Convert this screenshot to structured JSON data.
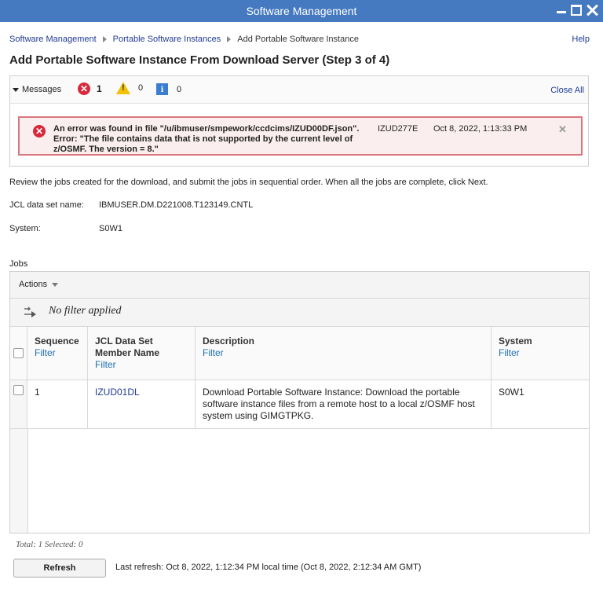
{
  "window": {
    "title": "Software Management"
  },
  "breadcrumb": {
    "items": [
      "Software Management",
      "Portable Software Instances"
    ],
    "current": "Add Portable Software Instance"
  },
  "help_label": "Help",
  "page_title": "Add Portable Software Instance From Download Server (Step 3 of 4)",
  "messages": {
    "toggle_label": "Messages",
    "error_count": "1",
    "warning_count": "0",
    "info_count": "0",
    "close_all": "Close All",
    "error": {
      "text": "An error was found in file \"/u/ibmuser/smpework/ccdcims/IZUD00DF.json\". Error: \"The file contains data that is not supported by the current level of z/OSMF.  The version = 8.\"",
      "code": "IZUD277E",
      "time": "Oct 8, 2022, 1:13:33 PM"
    }
  },
  "instructions": "Review the jobs created for the download, and submit the jobs in sequential order. When all the jobs are complete, click Next.",
  "jcl": {
    "label": "JCL data set name:",
    "value": "IBMUSER.DM.D221008.T123149.CNTL"
  },
  "system": {
    "label": "System:",
    "value": "S0W1"
  },
  "jobs": {
    "label": "Jobs",
    "actions_label": "Actions",
    "filter_status": "No filter applied",
    "columns": [
      {
        "label": "Sequence",
        "filter": "Filter"
      },
      {
        "label": "JCL Data Set Member Name",
        "filter": "Filter"
      },
      {
        "label": "Description",
        "filter": "Filter"
      },
      {
        "label": "System",
        "filter": "Filter"
      }
    ],
    "rows": [
      {
        "sequence": "1",
        "member": "IZUD01DL",
        "description": "Download Portable Software Instance:  Download the portable software instance files from a remote host to a local z/OSMF host system using GIMGTPKG.",
        "system": "S0W1"
      }
    ]
  },
  "footer": {
    "totals": "Total: 1 Selected: 0",
    "refresh_label": "Refresh",
    "last_refresh": "Last refresh: Oct 8, 2022, 1:12:34 PM local time (Oct 8, 2022, 2:12:34 AM GMT)"
  }
}
